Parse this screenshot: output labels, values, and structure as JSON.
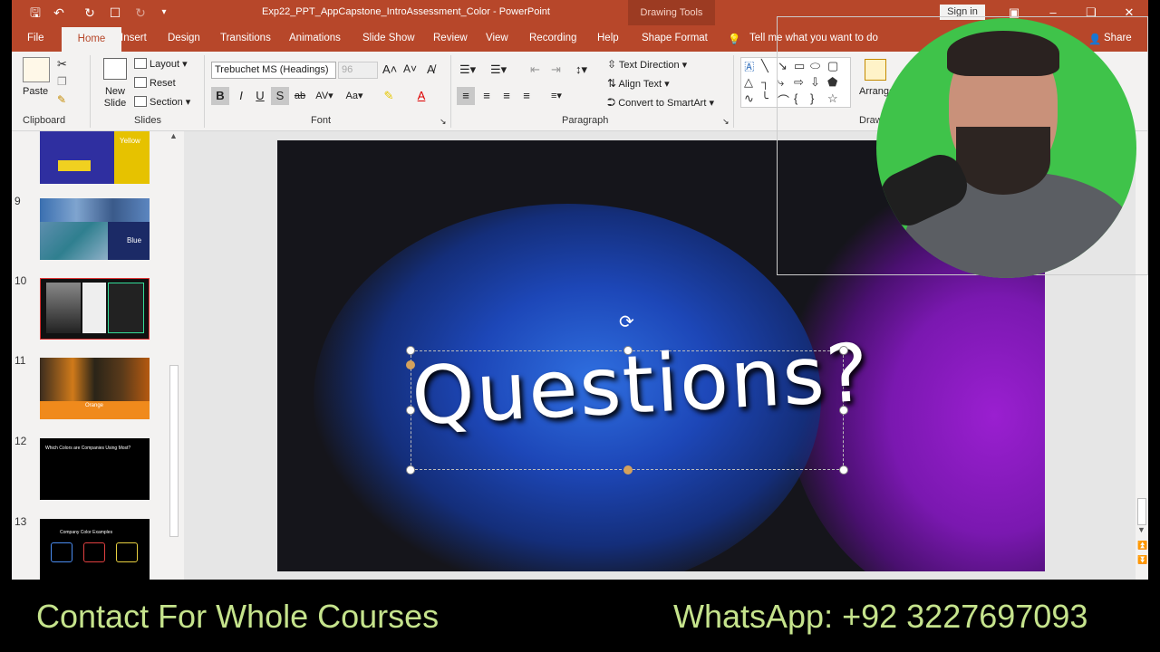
{
  "window": {
    "title": "Exp22_PPT_AppCapstone_IntroAssessment_Color - PowerPoint",
    "context_tools": "Drawing Tools",
    "sign_in": "Sign in"
  },
  "tabs": [
    {
      "label": "File"
    },
    {
      "label": "Home"
    },
    {
      "label": "Insert"
    },
    {
      "label": "Design"
    },
    {
      "label": "Transitions"
    },
    {
      "label": "Animations"
    },
    {
      "label": "Slide Show"
    },
    {
      "label": "Review"
    },
    {
      "label": "View"
    },
    {
      "label": "Recording"
    },
    {
      "label": "Help"
    },
    {
      "label": "Shape Format"
    }
  ],
  "tell_me": "Tell me what you want to do",
  "share": "Share",
  "ribbon": {
    "clipboard": {
      "paste": "Paste",
      "label": "Clipboard"
    },
    "slides": {
      "new_slide": "New Slide",
      "layout": "Layout",
      "reset": "Reset",
      "section": "Section",
      "label": "Slides"
    },
    "font": {
      "name": "Trebuchet MS (Headings)",
      "size": "96",
      "label": "Font"
    },
    "paragraph": {
      "text_direction": "Text Direction",
      "align_text": "Align Text",
      "convert_smartart": "Convert to SmartArt",
      "label": "Paragraph"
    },
    "drawing": {
      "arrange": "Arrange",
      "label": "Draw"
    }
  },
  "slides_panel": [
    {
      "num": "",
      "label": "Yellow"
    },
    {
      "num": "9",
      "label": "Blue"
    },
    {
      "num": "10",
      "label": ""
    },
    {
      "num": "11",
      "label": "Orange"
    },
    {
      "num": "12",
      "label": "Which Colors are Companies Using Most?"
    },
    {
      "num": "13",
      "label": "Company Color Examples"
    }
  ],
  "slide": {
    "text": "Questions?"
  },
  "banner": {
    "left": "Contact For Whole Courses",
    "right": "WhatsApp:  +92 3227697093"
  },
  "colors": {
    "accent": "#b7472a",
    "banner_text": "#c5e38c"
  }
}
